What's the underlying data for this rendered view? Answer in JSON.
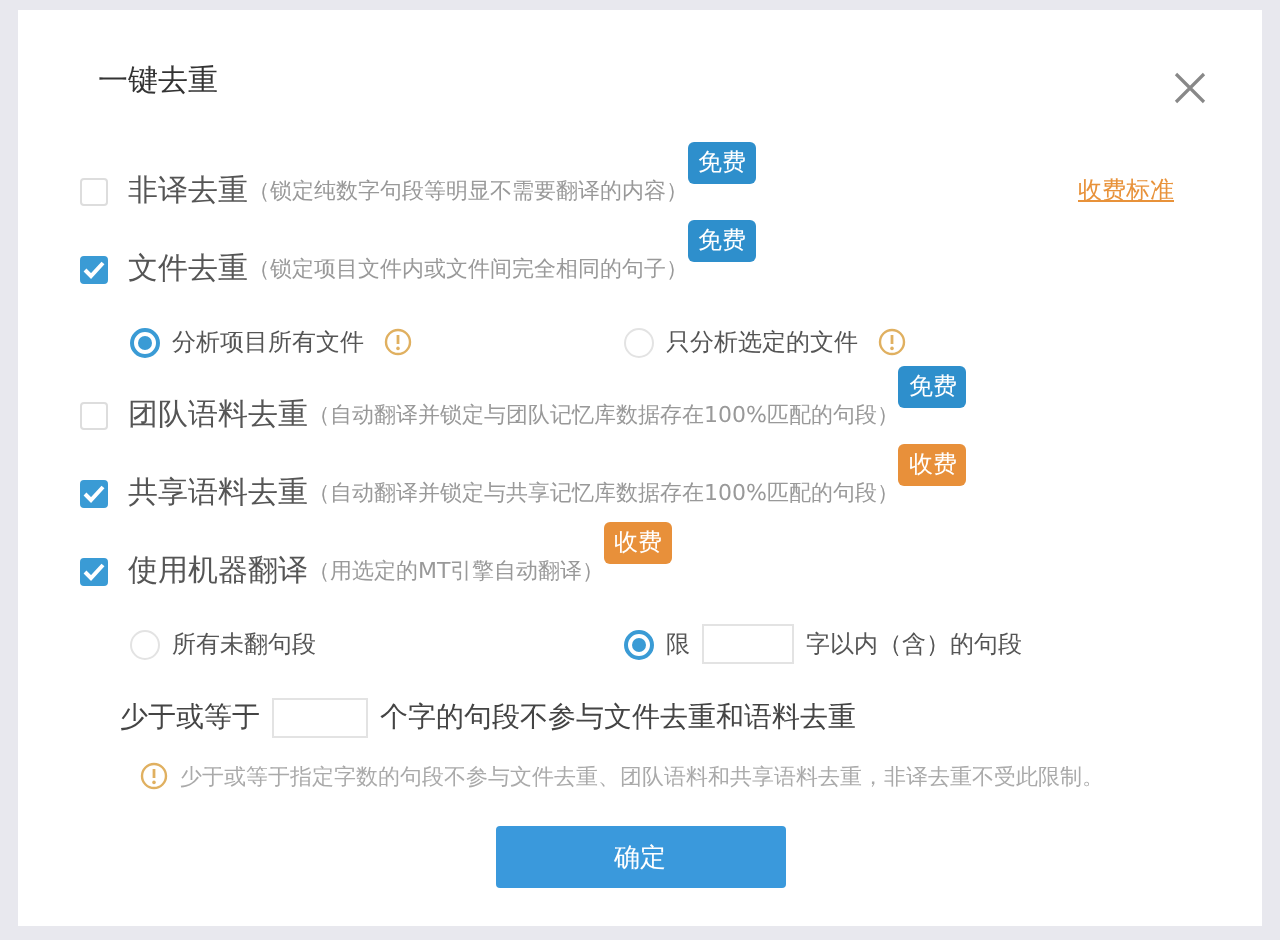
{
  "dialog": {
    "title": "一键去重"
  },
  "options": [
    {
      "label": "非译去重",
      "note": "（锁定纯数字句段等明显不需要翻译的内容）",
      "checked": false,
      "badge": {
        "text": "免费",
        "kind": "free"
      },
      "link": "收费标准"
    },
    {
      "label": "文件去重",
      "note": "（锁定项目文件内或文件间完全相同的句子）",
      "checked": true,
      "badge": {
        "text": "免费",
        "kind": "free"
      },
      "suboptions": [
        {
          "kind": "radio",
          "label": "分析项目所有文件",
          "selected": true,
          "info": true
        },
        {
          "kind": "radio",
          "label": "只分析选定的文件",
          "selected": false,
          "info": true
        }
      ]
    },
    {
      "label": "团队语料去重",
      "note": "（自动翻译并锁定与团队记忆库数据存在100%匹配的句段）",
      "checked": false,
      "badge": {
        "text": "免费",
        "kind": "free"
      }
    },
    {
      "label": "共享语料去重",
      "note": "（自动翻译并锁定与共享记忆库数据存在100%匹配的句段）",
      "checked": true,
      "badge": {
        "text": "收费",
        "kind": "paid"
      }
    },
    {
      "label": "使用机器翻译",
      "note": "（用选定的MT引擎自动翻译）",
      "checked": true,
      "badge": {
        "text": "收费",
        "kind": "paid"
      },
      "suboptions": [
        {
          "kind": "radio",
          "label": "所有未翻句段",
          "selected": false,
          "info": false
        },
        {
          "kind": "limit",
          "before": "限",
          "after": "字以内（含）的句段",
          "selected": true
        }
      ]
    }
  ],
  "threshold": {
    "before": "少于或等于",
    "after": "个字的句段不参与文件去重和语料去重"
  },
  "note": "少于或等于指定字数的句段不参与文件去重、团队语料和共享语料去重，非译去重不受此限制。",
  "button": "确定"
}
